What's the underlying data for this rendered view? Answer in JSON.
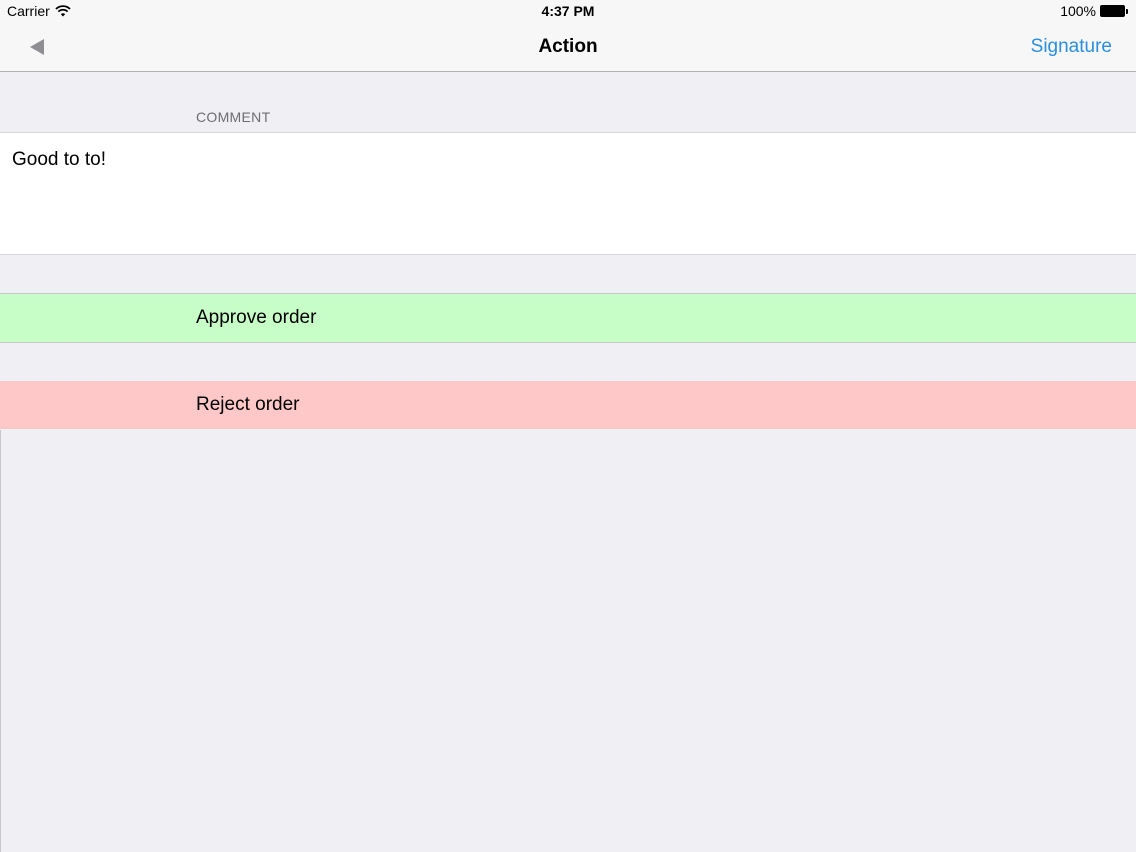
{
  "status_bar": {
    "carrier": "Carrier",
    "time": "4:37 PM",
    "battery": "100%"
  },
  "nav": {
    "back_icon": "back-arrow-icon",
    "title": "Action",
    "right_button": "Signature"
  },
  "comment_section": {
    "header": "COMMENT",
    "value": "Good to to!"
  },
  "actions": [
    {
      "label": "Approve order",
      "color": "#c7fdc7"
    },
    {
      "label": "Reject order",
      "color": "#ffc8c8"
    }
  ],
  "colors": {
    "accent": "#2a8fdb",
    "background": "#efeff4"
  }
}
